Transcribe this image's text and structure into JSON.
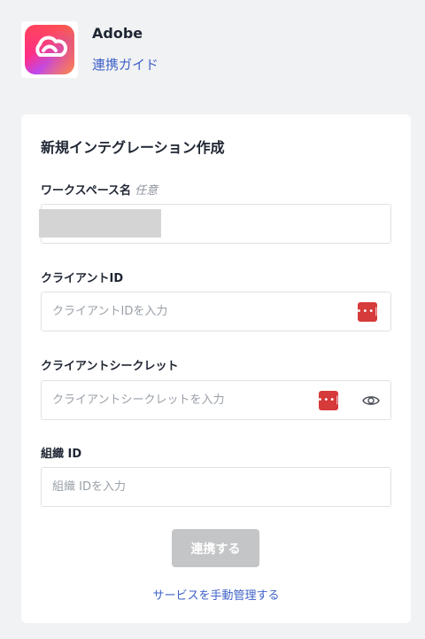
{
  "header": {
    "app_name": "Adobe",
    "guide_link": "連携ガイド",
    "logo_icon": "adobe-creative-cloud-logo"
  },
  "form": {
    "title": "新規インテグレーション作成",
    "workspace": {
      "label": "ワークスペース名",
      "optional": "任意",
      "value": ""
    },
    "client_id": {
      "label": "クライアントID",
      "placeholder": "クライアントIDを入力"
    },
    "client_secret": {
      "label": "クライアントシークレット",
      "placeholder": "クライアントシークレットを入力"
    },
    "org_id": {
      "label": "組織 ID",
      "placeholder": "組織 IDを入力"
    },
    "submit_label": "連携する",
    "manual_link": "サービスを手動管理する"
  },
  "colors": {
    "accent_link": "#3f62c8",
    "password_manager_icon": "#d63a3a",
    "disabled_button": "#c4c5c7"
  }
}
